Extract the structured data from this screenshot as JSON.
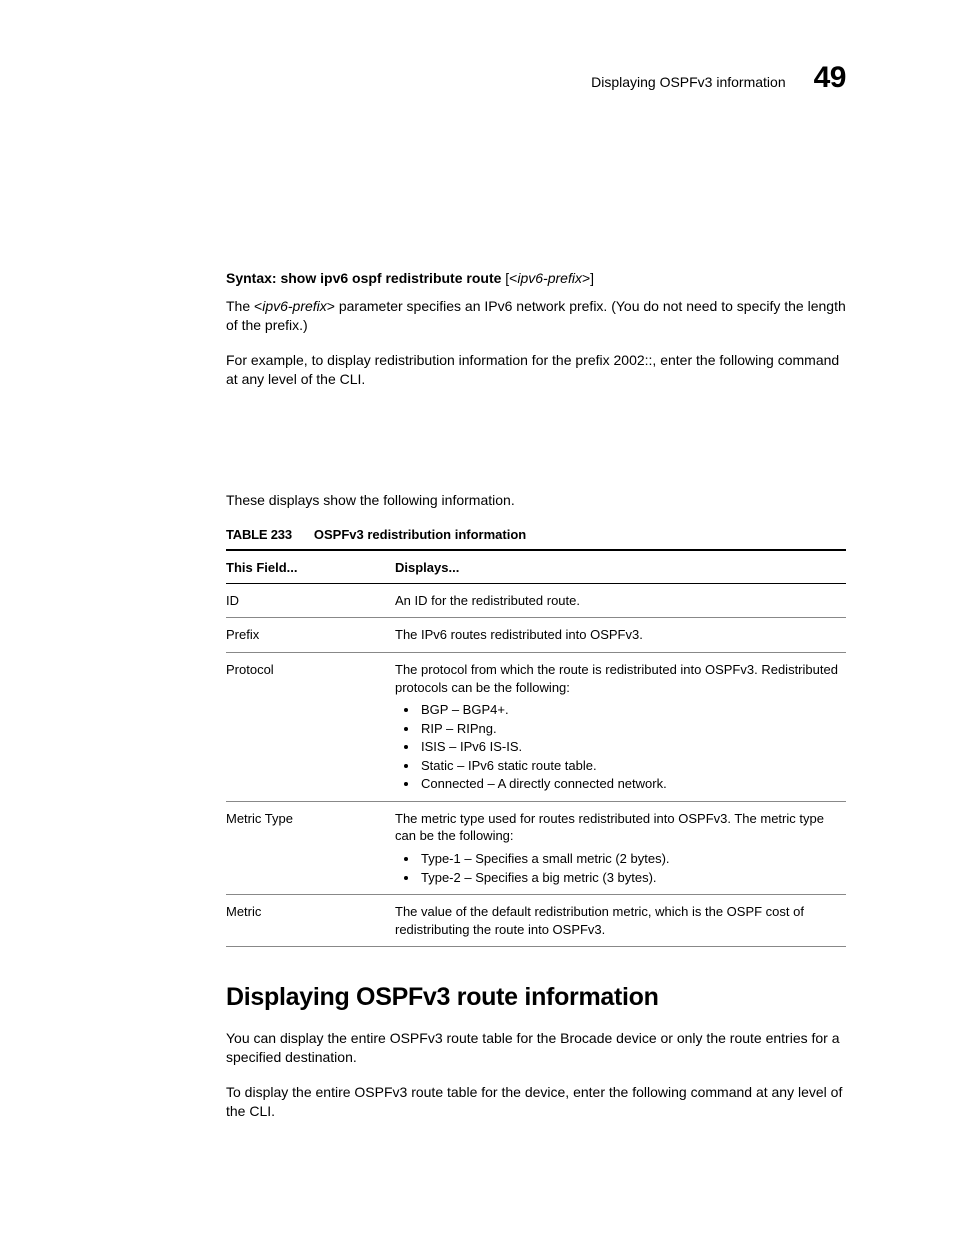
{
  "header": {
    "running_title": "Displaying OSPFv3 information",
    "chapter_number": "49"
  },
  "syntax": {
    "label": "Syntax:",
    "command": "show ipv6 ospf redistribute route",
    "opt_open": "[<",
    "opt_arg": "ipv6-prefix",
    "opt_close": ">]"
  },
  "para1_a": "The <",
  "para1_arg": "ipv6-prefix",
  "para1_b": "> parameter specifies an IPv6 network prefix. (You do not need to specify the length of the prefix.)",
  "para2": "For example, to display redistribution information for the prefix 2002::, enter the following command at any level of the CLI.",
  "para3": "These displays show the following information.",
  "table": {
    "caption_label": "TABLE 233",
    "caption_title": "OSPFv3 redistribution information",
    "head_field": "This Field...",
    "head_displays": "Displays...",
    "rows": {
      "r0_field": "ID",
      "r0_desc": "An ID for the redistributed route.",
      "r1_field": "Prefix",
      "r1_desc": "The IPv6 routes redistributed into OSPFv3.",
      "r2_field": "Protocol",
      "r2_desc": "The protocol from which the route is redistributed into OSPFv3. Redistributed protocols can be the following:",
      "r2_li0": "BGP – BGP4+.",
      "r2_li1": "RIP – RIPng.",
      "r2_li2": "ISIS – IPv6 IS-IS.",
      "r2_li3": "Static – IPv6 static route table.",
      "r2_li4": "Connected – A directly connected network.",
      "r3_field": "Metric Type",
      "r3_desc": "The metric type used for routes redistributed into OSPFv3. The metric type can be the following:",
      "r3_li0": "Type-1 – Specifies a small metric (2 bytes).",
      "r3_li1": "Type-2 – Specifies a big metric (3 bytes).",
      "r4_field": "Metric",
      "r4_desc": "The value of the default redistribution metric, which is the OSPF cost of redistributing the route into OSPFv3."
    }
  },
  "section": {
    "title": "Displaying OSPFv3 route information",
    "p1": "You can display the entire OSPFv3 route table for the Brocade device or only the route entries for a specified destination.",
    "p2": "To display the entire OSPFv3 route table for the device, enter the following command at any level of the CLI."
  }
}
